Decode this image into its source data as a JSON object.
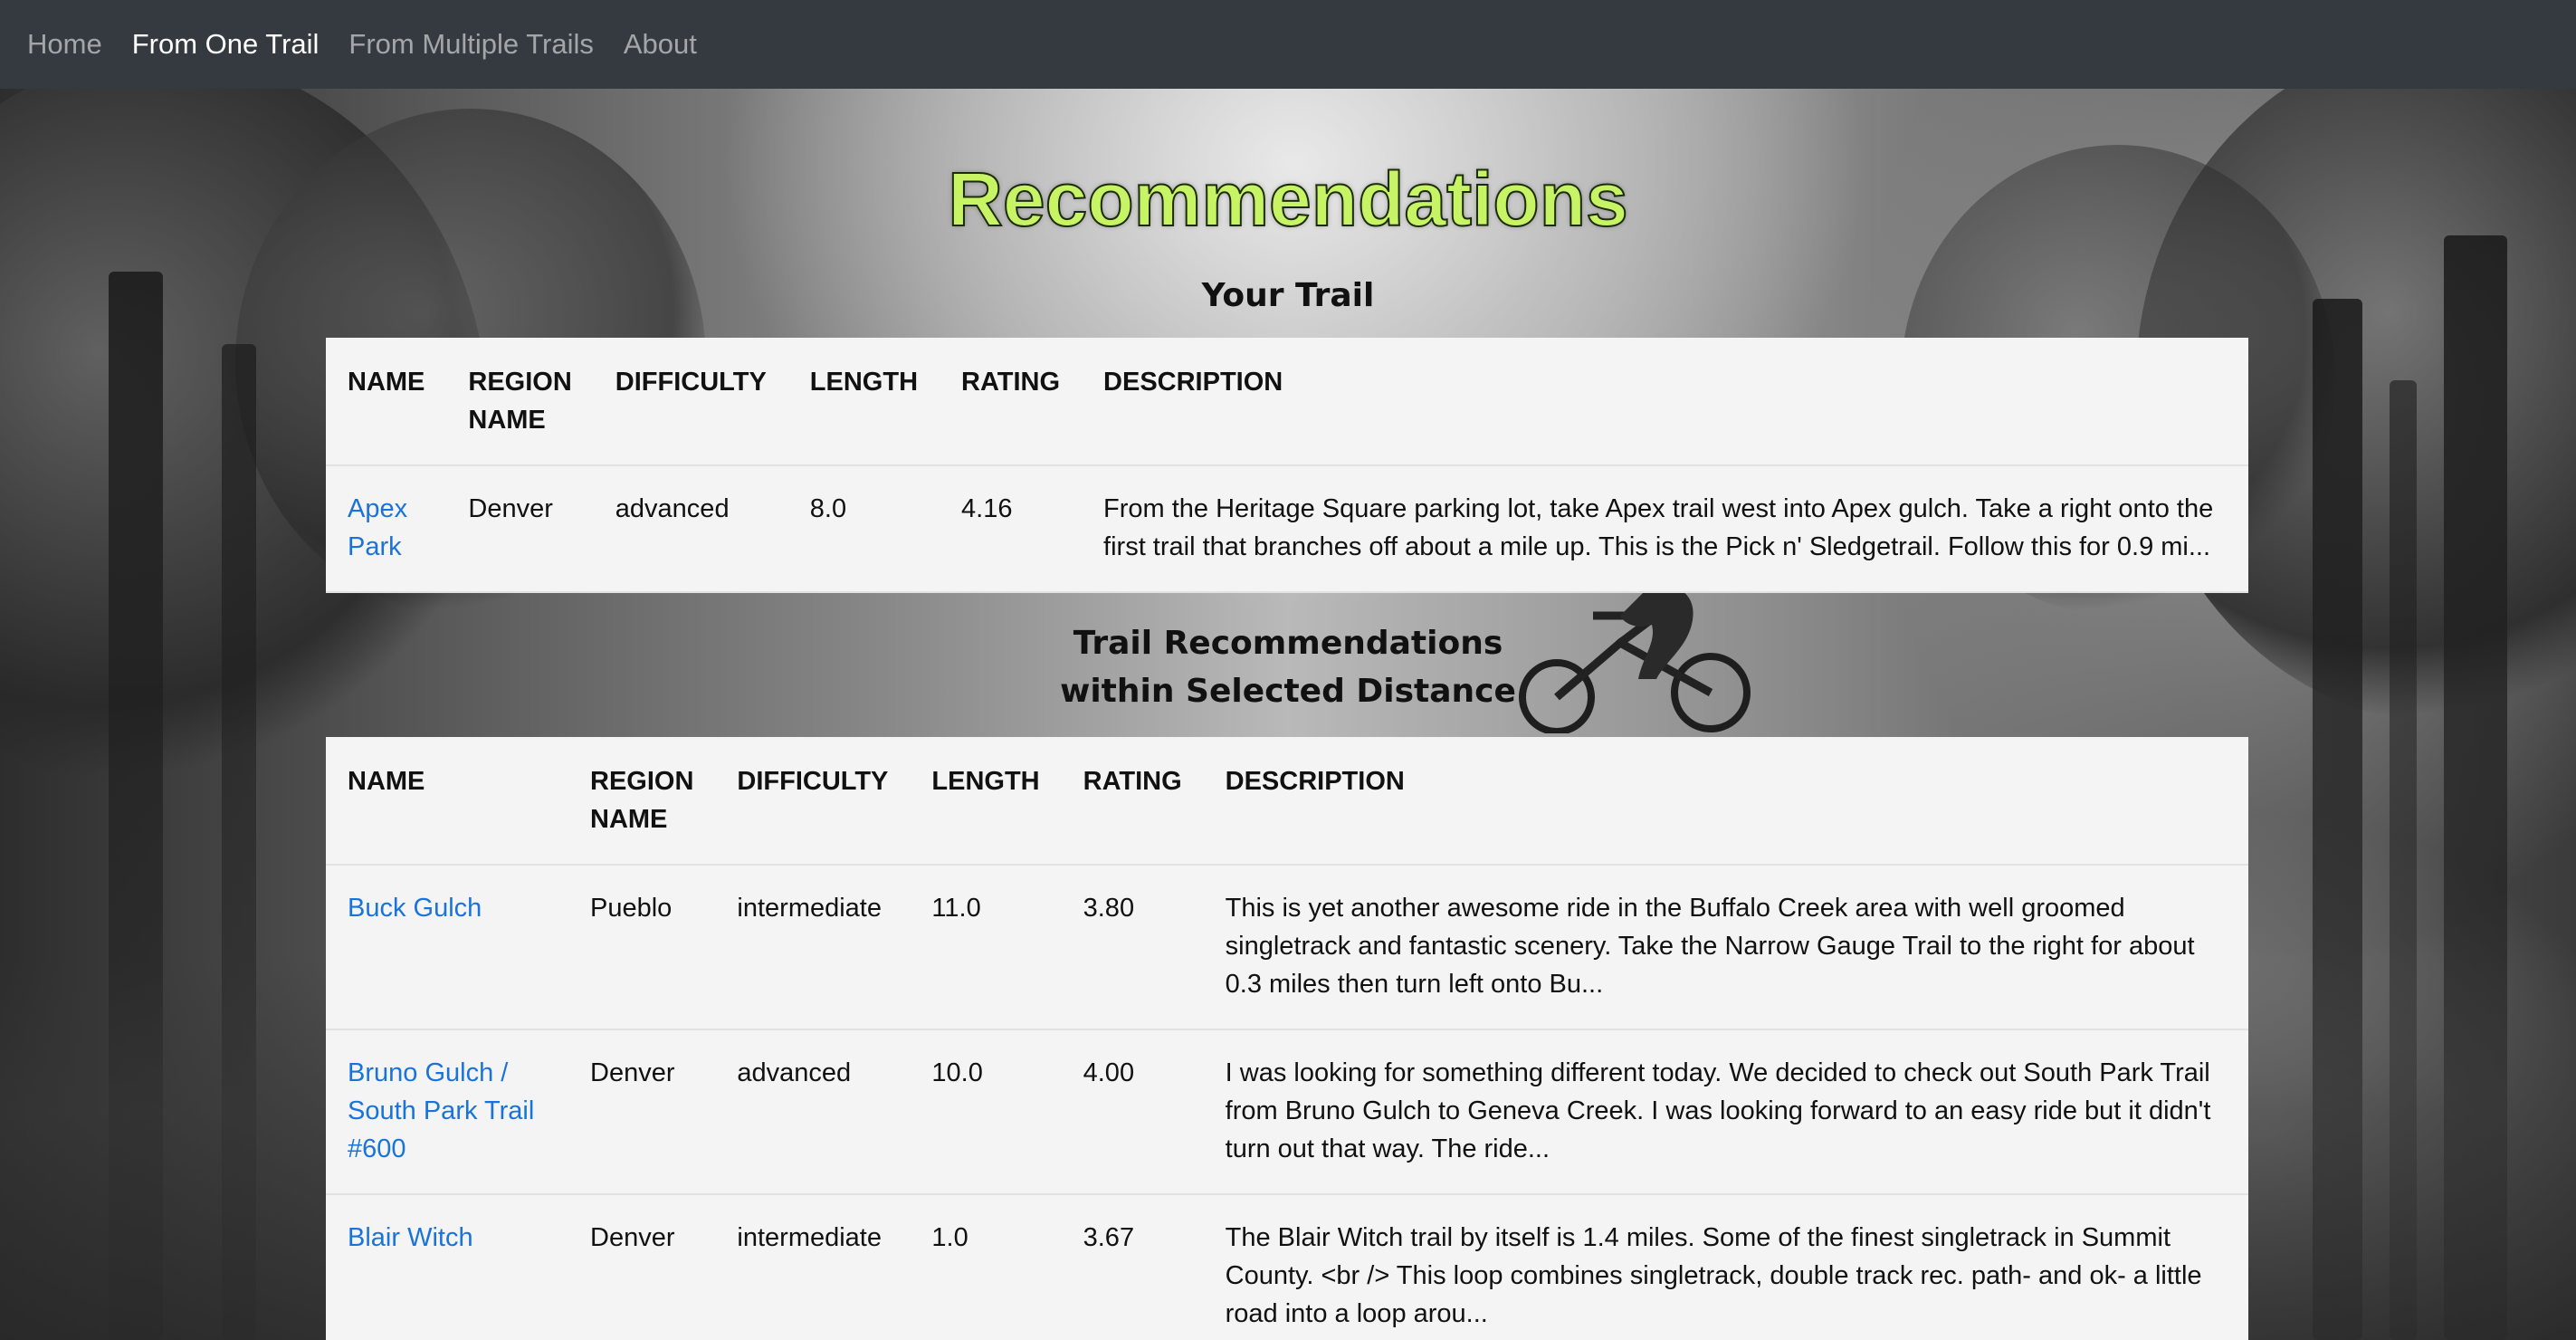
{
  "nav": {
    "items": [
      {
        "label": "Home",
        "active": false
      },
      {
        "label": "From One Trail",
        "active": true
      },
      {
        "label": "From Multiple Trails",
        "active": false
      },
      {
        "label": "About",
        "active": false
      }
    ]
  },
  "page": {
    "title": "Recommendations"
  },
  "your_trail": {
    "heading": "Your Trail",
    "columns": [
      "NAME",
      "REGION NAME",
      "DIFFICULTY",
      "LENGTH",
      "RATING",
      "DESCRIPTION"
    ],
    "rows": [
      {
        "name": "Apex Park",
        "region": "Denver",
        "difficulty": "advanced",
        "length": "8.0",
        "rating": "4.16",
        "description": "From the Heritage Square parking lot, take Apex trail west into Apex gulch. Take a right onto the first trail that branches off about a mile up. This is the Pick n' Sledgetrail. Follow this for 0.9 mi..."
      }
    ]
  },
  "recommendations": {
    "heading_line1": "Trail Recommendations",
    "heading_line2": "within Selected Distance",
    "columns": [
      "NAME",
      "REGION NAME",
      "DIFFICULTY",
      "LENGTH",
      "RATING",
      "DESCRIPTION"
    ],
    "rows": [
      {
        "name": "Buck Gulch",
        "region": "Pueblo",
        "difficulty": "intermediate",
        "length": "11.0",
        "rating": "3.80",
        "description": "This is yet another awesome ride in the Buffalo Creek area with well groomed singletrack and fantastic scenery. Take the Narrow Gauge Trail to the right for about 0.3 miles then turn left onto Bu..."
      },
      {
        "name": "Bruno Gulch / South Park Trail #600",
        "region": "Denver",
        "difficulty": "advanced",
        "length": "10.0",
        "rating": "4.00",
        "description": "I was looking for something different today. We decided to check out South Park Trail from Bruno Gulch to Geneva Creek. I was looking forward to an easy ride but it didn't turn out that way. The ride..."
      },
      {
        "name": "Blair Witch",
        "region": "Denver",
        "difficulty": "intermediate",
        "length": "1.0",
        "rating": "3.67",
        "description": "The Blair Witch trail by itself is 1.4 miles. Some of the finest singletrack in Summit County. <br /> This loop combines singletrack, double track rec. path- and ok- a little road into a loop arou..."
      }
    ]
  },
  "colors": {
    "navbar_bg": "#343a40",
    "title_fill": "#c7f464",
    "link": "#1a73d9",
    "table_bg": "#f4f4f4"
  }
}
